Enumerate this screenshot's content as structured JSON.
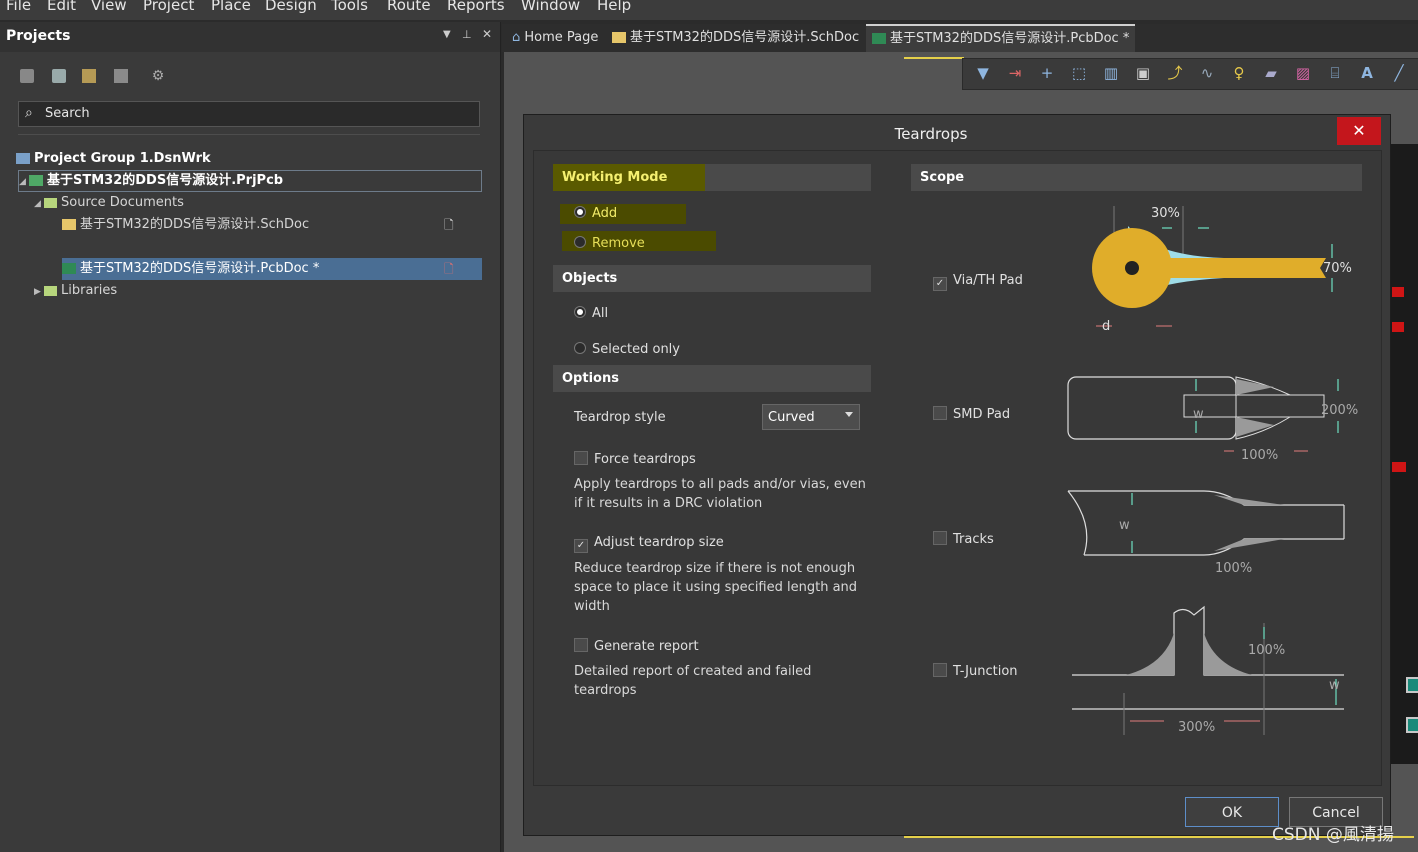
{
  "menu": [
    "File",
    "Edit",
    "View",
    "Project",
    "Place",
    "Design",
    "Tools",
    "Route",
    "Reports",
    "Window",
    "Help"
  ],
  "projects": {
    "title": "Projects",
    "search_placeholder": "Search",
    "tree": {
      "group": "Project Group 1.DsnWrk",
      "project": "基于STM32的DDS信号源设计.PrjPcb",
      "source_folder": "Source Documents",
      "sch_doc": "基于STM32的DDS信号源设计.SchDoc",
      "pcb_doc": "基于STM32的DDS信号源设计.PcbDoc *",
      "libraries": "Libraries"
    }
  },
  "tabs": [
    "Home Page",
    "基于STM32的DDS信号源设计.SchDoc",
    "基于STM32的DDS信号源设计.PcbDoc *"
  ],
  "dialog": {
    "title": "Teardrops",
    "close": "✕",
    "working_mode": {
      "header": "Working Mode",
      "add": "Add",
      "remove": "Remove",
      "selected": "Add"
    },
    "objects": {
      "header": "Objects",
      "all": "All",
      "selected_only": "Selected only",
      "selected": "All"
    },
    "options": {
      "header": "Options",
      "style_label": "Teardrop style",
      "style_value": "Curved",
      "force_label": "Force teardrops",
      "force_checked": false,
      "force_desc_1": "Apply teardrops to all pads and/or vias, even",
      "force_desc_2": "if it results in a DRC violation",
      "adjust_label": "Adjust teardrop size",
      "adjust_checked": true,
      "adjust_desc_1": "Reduce teardrop size if there is not enough",
      "adjust_desc_2": "space to place it using specified length and",
      "adjust_desc_3": "width",
      "report_label": "Generate report",
      "report_checked": false,
      "report_desc_1": "Detailed report of created and failed",
      "report_desc_2": "teardrops"
    },
    "scope": {
      "header": "Scope",
      "via": {
        "label": "Via/TH Pad",
        "checked": true,
        "pct_top": "30%",
        "pct_right": "70%",
        "d": "d"
      },
      "smd": {
        "label": "SMD Pad",
        "checked": false,
        "w": "w",
        "pct_right": "200%",
        "pct_bottom": "100%"
      },
      "tracks": {
        "label": "Tracks",
        "checked": false,
        "w": "w",
        "pct_bottom": "100%"
      },
      "tjunction": {
        "label": "T-Junction",
        "checked": false,
        "pct_top": "100%",
        "w": "w",
        "pct_bottom": "300%"
      }
    },
    "ok": "OK",
    "cancel": "Cancel"
  },
  "watermark": "CSDN @風清揚"
}
